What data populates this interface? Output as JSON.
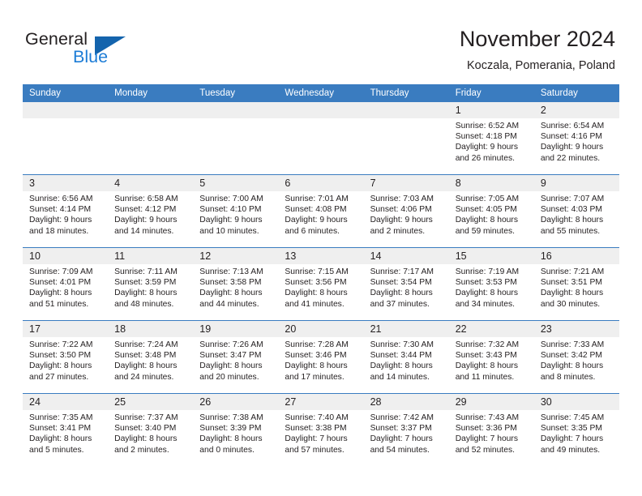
{
  "brand": {
    "name_part1": "General",
    "name_part2": "Blue",
    "accent_color": "#1c7cd6",
    "triangle_color": "#1464ad"
  },
  "header": {
    "title": "November 2024",
    "subtitle": "Koczala, Pomerania, Poland"
  },
  "theme": {
    "header_row_bg": "#3a7cc0",
    "day_band_bg": "#efefef",
    "text_color": "#231f20"
  },
  "weekdays": [
    "Sunday",
    "Monday",
    "Tuesday",
    "Wednesday",
    "Thursday",
    "Friday",
    "Saturday"
  ],
  "weeks": [
    [
      {
        "day": "",
        "sunrise": "",
        "sunset": "",
        "daylight1": "",
        "daylight2": ""
      },
      {
        "day": "",
        "sunrise": "",
        "sunset": "",
        "daylight1": "",
        "daylight2": ""
      },
      {
        "day": "",
        "sunrise": "",
        "sunset": "",
        "daylight1": "",
        "daylight2": ""
      },
      {
        "day": "",
        "sunrise": "",
        "sunset": "",
        "daylight1": "",
        "daylight2": ""
      },
      {
        "day": "",
        "sunrise": "",
        "sunset": "",
        "daylight1": "",
        "daylight2": ""
      },
      {
        "day": "1",
        "sunrise": "Sunrise: 6:52 AM",
        "sunset": "Sunset: 4:18 PM",
        "daylight1": "Daylight: 9 hours",
        "daylight2": "and 26 minutes."
      },
      {
        "day": "2",
        "sunrise": "Sunrise: 6:54 AM",
        "sunset": "Sunset: 4:16 PM",
        "daylight1": "Daylight: 9 hours",
        "daylight2": "and 22 minutes."
      }
    ],
    [
      {
        "day": "3",
        "sunrise": "Sunrise: 6:56 AM",
        "sunset": "Sunset: 4:14 PM",
        "daylight1": "Daylight: 9 hours",
        "daylight2": "and 18 minutes."
      },
      {
        "day": "4",
        "sunrise": "Sunrise: 6:58 AM",
        "sunset": "Sunset: 4:12 PM",
        "daylight1": "Daylight: 9 hours",
        "daylight2": "and 14 minutes."
      },
      {
        "day": "5",
        "sunrise": "Sunrise: 7:00 AM",
        "sunset": "Sunset: 4:10 PM",
        "daylight1": "Daylight: 9 hours",
        "daylight2": "and 10 minutes."
      },
      {
        "day": "6",
        "sunrise": "Sunrise: 7:01 AM",
        "sunset": "Sunset: 4:08 PM",
        "daylight1": "Daylight: 9 hours",
        "daylight2": "and 6 minutes."
      },
      {
        "day": "7",
        "sunrise": "Sunrise: 7:03 AM",
        "sunset": "Sunset: 4:06 PM",
        "daylight1": "Daylight: 9 hours",
        "daylight2": "and 2 minutes."
      },
      {
        "day": "8",
        "sunrise": "Sunrise: 7:05 AM",
        "sunset": "Sunset: 4:05 PM",
        "daylight1": "Daylight: 8 hours",
        "daylight2": "and 59 minutes."
      },
      {
        "day": "9",
        "sunrise": "Sunrise: 7:07 AM",
        "sunset": "Sunset: 4:03 PM",
        "daylight1": "Daylight: 8 hours",
        "daylight2": "and 55 minutes."
      }
    ],
    [
      {
        "day": "10",
        "sunrise": "Sunrise: 7:09 AM",
        "sunset": "Sunset: 4:01 PM",
        "daylight1": "Daylight: 8 hours",
        "daylight2": "and 51 minutes."
      },
      {
        "day": "11",
        "sunrise": "Sunrise: 7:11 AM",
        "sunset": "Sunset: 3:59 PM",
        "daylight1": "Daylight: 8 hours",
        "daylight2": "and 48 minutes."
      },
      {
        "day": "12",
        "sunrise": "Sunrise: 7:13 AM",
        "sunset": "Sunset: 3:58 PM",
        "daylight1": "Daylight: 8 hours",
        "daylight2": "and 44 minutes."
      },
      {
        "day": "13",
        "sunrise": "Sunrise: 7:15 AM",
        "sunset": "Sunset: 3:56 PM",
        "daylight1": "Daylight: 8 hours",
        "daylight2": "and 41 minutes."
      },
      {
        "day": "14",
        "sunrise": "Sunrise: 7:17 AM",
        "sunset": "Sunset: 3:54 PM",
        "daylight1": "Daylight: 8 hours",
        "daylight2": "and 37 minutes."
      },
      {
        "day": "15",
        "sunrise": "Sunrise: 7:19 AM",
        "sunset": "Sunset: 3:53 PM",
        "daylight1": "Daylight: 8 hours",
        "daylight2": "and 34 minutes."
      },
      {
        "day": "16",
        "sunrise": "Sunrise: 7:21 AM",
        "sunset": "Sunset: 3:51 PM",
        "daylight1": "Daylight: 8 hours",
        "daylight2": "and 30 minutes."
      }
    ],
    [
      {
        "day": "17",
        "sunrise": "Sunrise: 7:22 AM",
        "sunset": "Sunset: 3:50 PM",
        "daylight1": "Daylight: 8 hours",
        "daylight2": "and 27 minutes."
      },
      {
        "day": "18",
        "sunrise": "Sunrise: 7:24 AM",
        "sunset": "Sunset: 3:48 PM",
        "daylight1": "Daylight: 8 hours",
        "daylight2": "and 24 minutes."
      },
      {
        "day": "19",
        "sunrise": "Sunrise: 7:26 AM",
        "sunset": "Sunset: 3:47 PM",
        "daylight1": "Daylight: 8 hours",
        "daylight2": "and 20 minutes."
      },
      {
        "day": "20",
        "sunrise": "Sunrise: 7:28 AM",
        "sunset": "Sunset: 3:46 PM",
        "daylight1": "Daylight: 8 hours",
        "daylight2": "and 17 minutes."
      },
      {
        "day": "21",
        "sunrise": "Sunrise: 7:30 AM",
        "sunset": "Sunset: 3:44 PM",
        "daylight1": "Daylight: 8 hours",
        "daylight2": "and 14 minutes."
      },
      {
        "day": "22",
        "sunrise": "Sunrise: 7:32 AM",
        "sunset": "Sunset: 3:43 PM",
        "daylight1": "Daylight: 8 hours",
        "daylight2": "and 11 minutes."
      },
      {
        "day": "23",
        "sunrise": "Sunrise: 7:33 AM",
        "sunset": "Sunset: 3:42 PM",
        "daylight1": "Daylight: 8 hours",
        "daylight2": "and 8 minutes."
      }
    ],
    [
      {
        "day": "24",
        "sunrise": "Sunrise: 7:35 AM",
        "sunset": "Sunset: 3:41 PM",
        "daylight1": "Daylight: 8 hours",
        "daylight2": "and 5 minutes."
      },
      {
        "day": "25",
        "sunrise": "Sunrise: 7:37 AM",
        "sunset": "Sunset: 3:40 PM",
        "daylight1": "Daylight: 8 hours",
        "daylight2": "and 2 minutes."
      },
      {
        "day": "26",
        "sunrise": "Sunrise: 7:38 AM",
        "sunset": "Sunset: 3:39 PM",
        "daylight1": "Daylight: 8 hours",
        "daylight2": "and 0 minutes."
      },
      {
        "day": "27",
        "sunrise": "Sunrise: 7:40 AM",
        "sunset": "Sunset: 3:38 PM",
        "daylight1": "Daylight: 7 hours",
        "daylight2": "and 57 minutes."
      },
      {
        "day": "28",
        "sunrise": "Sunrise: 7:42 AM",
        "sunset": "Sunset: 3:37 PM",
        "daylight1": "Daylight: 7 hours",
        "daylight2": "and 54 minutes."
      },
      {
        "day": "29",
        "sunrise": "Sunrise: 7:43 AM",
        "sunset": "Sunset: 3:36 PM",
        "daylight1": "Daylight: 7 hours",
        "daylight2": "and 52 minutes."
      },
      {
        "day": "30",
        "sunrise": "Sunrise: 7:45 AM",
        "sunset": "Sunset: 3:35 PM",
        "daylight1": "Daylight: 7 hours",
        "daylight2": "and 49 minutes."
      }
    ]
  ]
}
